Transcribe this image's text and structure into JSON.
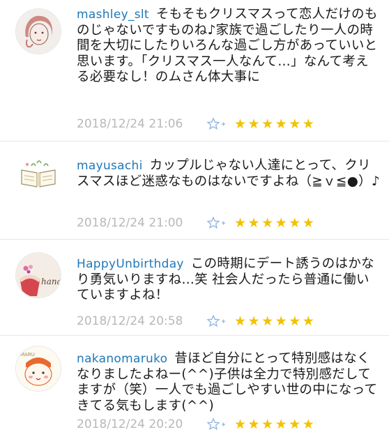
{
  "comments": [
    {
      "username": "mashley_slt",
      "text": "そもそもクリスマスって恋人だけのものじゃないですものね♪家族で過ごしたり一人の時間を大切にしたりいろんな過ごし方があっていいと思います。「クリスマス一人なんて…」なんて考える必要なし！のムさん体大事に",
      "timestamp": "2018/12/24 21:06",
      "rating": 6,
      "avatar_icon": "woman-face-sketch-icon"
    },
    {
      "username": "mayusachi",
      "text": "カップルじゃない人達にとって、クリスマスほど迷惑なものはないですよね（≧ｖ≦●）♪",
      "timestamp": "2018/12/24 21:00",
      "rating": 6,
      "avatar_icon": "open-book-icon"
    },
    {
      "username": "HappyUnbirthday",
      "text": "この時期にデート誘うのはかなり勇気いりますね…笑 社会人だったら普通に働いていますよね！",
      "timestamp": "2018/12/24 20:58",
      "rating": 6,
      "avatar_icon": "cupcake-hana-icon",
      "avatar_label": "hana"
    },
    {
      "username": "nakanomaruko",
      "text": "昔ほど自分にとって特別感はなくなりましたよねー(^^)子供は全力で特別感だしてますが（笑）一人でも過ごしやすい世の中になってきてる気もします(^^)",
      "timestamp": "2018/12/24 20:20",
      "rating": 6,
      "avatar_icon": "maru-character-icon",
      "avatar_label": "MARU"
    }
  ],
  "colors": {
    "username": "#1f78b8",
    "timestamp": "#b8b8b8",
    "star": "#f2c200",
    "fav_icon": "#8fb4e0"
  },
  "star_glyph": "★"
}
